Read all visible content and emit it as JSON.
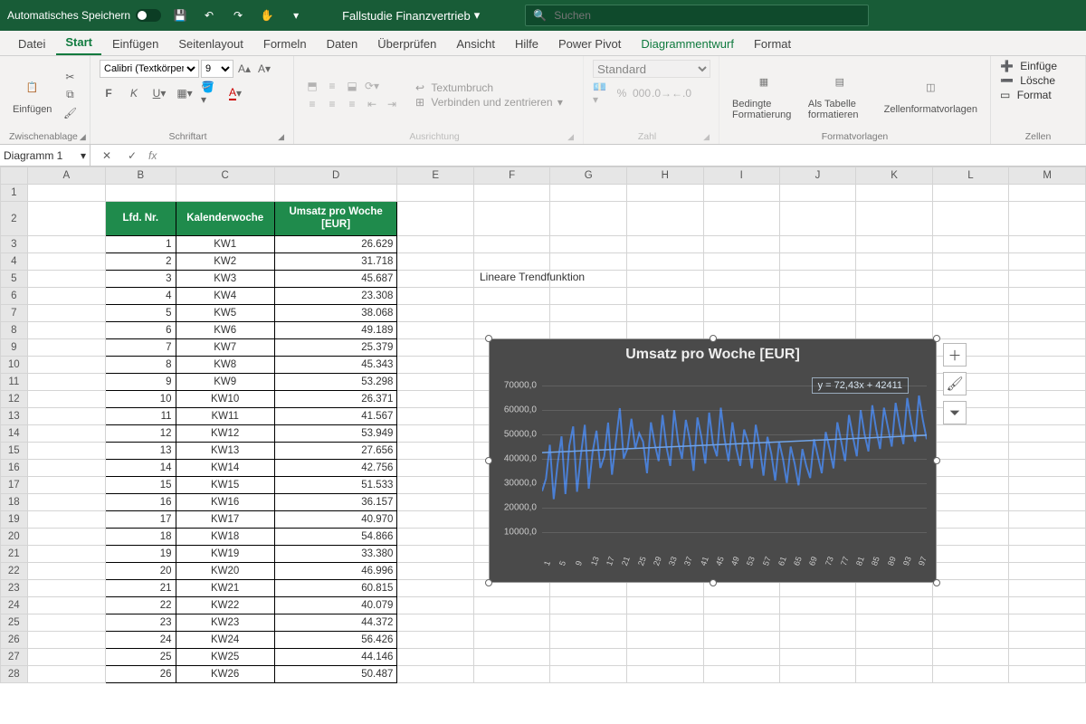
{
  "titlebar": {
    "autosave_label": "Automatisches Speichern",
    "doc_title": "Fallstudie Finanzvertrieb",
    "search_placeholder": "Suchen"
  },
  "tabs": {
    "datei": "Datei",
    "start": "Start",
    "einfuegen": "Einfügen",
    "seitenlayout": "Seitenlayout",
    "formeln": "Formeln",
    "daten": "Daten",
    "ueberpruefen": "Überprüfen",
    "ansicht": "Ansicht",
    "hilfe": "Hilfe",
    "powerpivot": "Power Pivot",
    "diagrammentwurf": "Diagrammentwurf",
    "format": "Format"
  },
  "ribbon": {
    "clipboard": {
      "label": "Zwischenablage",
      "paste": "Einfügen"
    },
    "font": {
      "label": "Schriftart",
      "font_name": "Calibri (Textkörper)",
      "font_size": "9"
    },
    "alignment": {
      "label": "Ausrichtung",
      "wrap": "Textumbruch",
      "merge": "Verbinden und zentrieren"
    },
    "number": {
      "label": "Zahl",
      "format": "Standard"
    },
    "styles": {
      "label": "Formatvorlagen",
      "conditional": "Bedingte Formatierung",
      "as_table": "Als Tabelle formatieren",
      "cell_styles": "Zellenformatvorlagen"
    },
    "cells": {
      "label": "Zellen",
      "insert": "Einfüge",
      "delete": "Lösche",
      "format": "Format"
    }
  },
  "namebox": "Diagramm 1",
  "sheet": {
    "headers": {
      "b": "Lfd. Nr.",
      "c": "Kalenderwoche",
      "d": "Umsatz pro Woche [EUR]"
    },
    "note": "Lineare Trendfunktion",
    "rows": [
      {
        "n": "1",
        "kw": "KW1",
        "v": "26.629"
      },
      {
        "n": "2",
        "kw": "KW2",
        "v": "31.718"
      },
      {
        "n": "3",
        "kw": "KW3",
        "v": "45.687"
      },
      {
        "n": "4",
        "kw": "KW4",
        "v": "23.308"
      },
      {
        "n": "5",
        "kw": "KW5",
        "v": "38.068"
      },
      {
        "n": "6",
        "kw": "KW6",
        "v": "49.189"
      },
      {
        "n": "7",
        "kw": "KW7",
        "v": "25.379"
      },
      {
        "n": "8",
        "kw": "KW8",
        "v": "45.343"
      },
      {
        "n": "9",
        "kw": "KW9",
        "v": "53.298"
      },
      {
        "n": "10",
        "kw": "KW10",
        "v": "26.371"
      },
      {
        "n": "11",
        "kw": "KW11",
        "v": "41.567"
      },
      {
        "n": "12",
        "kw": "KW12",
        "v": "53.949"
      },
      {
        "n": "13",
        "kw": "KW13",
        "v": "27.656"
      },
      {
        "n": "14",
        "kw": "KW14",
        "v": "42.756"
      },
      {
        "n": "15",
        "kw": "KW15",
        "v": "51.533"
      },
      {
        "n": "16",
        "kw": "KW16",
        "v": "36.157"
      },
      {
        "n": "17",
        "kw": "KW17",
        "v": "40.970"
      },
      {
        "n": "18",
        "kw": "KW18",
        "v": "54.866"
      },
      {
        "n": "19",
        "kw": "KW19",
        "v": "33.380"
      },
      {
        "n": "20",
        "kw": "KW20",
        "v": "46.996"
      },
      {
        "n": "21",
        "kw": "KW21",
        "v": "60.815"
      },
      {
        "n": "22",
        "kw": "KW22",
        "v": "40.079"
      },
      {
        "n": "23",
        "kw": "KW23",
        "v": "44.372"
      },
      {
        "n": "24",
        "kw": "KW24",
        "v": "56.426"
      },
      {
        "n": "25",
        "kw": "KW25",
        "v": "44.146"
      },
      {
        "n": "26",
        "kw": "KW26",
        "v": "50.487"
      }
    ]
  },
  "chart": {
    "title": "Umsatz pro Woche [EUR]",
    "equation": "y = 72,43x + 42411",
    "yticks": [
      "70000,0",
      "60000,0",
      "50000,0",
      "40000,0",
      "30000,0",
      "20000,0",
      "10000,0"
    ],
    "xticks": [
      "1",
      "5",
      "9",
      "13",
      "17",
      "21",
      "25",
      "29",
      "33",
      "37",
      "41",
      "45",
      "49",
      "53",
      "57",
      "61",
      "65",
      "69",
      "73",
      "77",
      "81",
      "85",
      "89",
      "93",
      "97"
    ]
  },
  "chart_data": {
    "type": "line",
    "title": "Umsatz pro Woche [EUR]",
    "xlabel": "",
    "ylabel": "",
    "ylim": [
      0,
      75000
    ],
    "x": [
      1,
      2,
      3,
      4,
      5,
      6,
      7,
      8,
      9,
      10,
      11,
      12,
      13,
      14,
      15,
      16,
      17,
      18,
      19,
      20,
      21,
      22,
      23,
      24,
      25,
      26,
      27,
      28,
      29,
      30,
      31,
      32,
      33,
      34,
      35,
      36,
      37,
      38,
      39,
      40,
      41,
      42,
      43,
      44,
      45,
      46,
      47,
      48,
      49,
      50,
      51,
      52,
      53,
      54,
      55,
      56,
      57,
      58,
      59,
      60,
      61,
      62,
      63,
      64,
      65,
      66,
      67,
      68,
      69,
      70,
      71,
      72,
      73,
      74,
      75,
      76,
      77,
      78,
      79,
      80,
      81,
      82,
      83,
      84,
      85,
      86,
      87,
      88,
      89,
      90,
      91,
      92,
      93,
      94,
      95,
      96,
      97,
      98,
      99,
      100
    ],
    "series": [
      {
        "name": "Umsatz",
        "values": [
          26629,
          31718,
          45687,
          23308,
          38068,
          49189,
          25379,
          45343,
          53298,
          26371,
          41567,
          53949,
          27656,
          42756,
          51533,
          36157,
          40970,
          54866,
          33380,
          46996,
          60815,
          40079,
          44372,
          56426,
          44146,
          50487,
          47000,
          34000,
          55000,
          46000,
          39000,
          58000,
          45000,
          37000,
          60000,
          47000,
          40000,
          56000,
          48000,
          35000,
          57000,
          49000,
          38000,
          59000,
          46000,
          41000,
          61000,
          48000,
          39000,
          55000,
          44000,
          37000,
          52000,
          47000,
          36000,
          54000,
          45000,
          33000,
          49000,
          42000,
          31000,
          47000,
          40000,
          30000,
          45000,
          38000,
          29000,
          44000,
          37000,
          32000,
          48000,
          41000,
          34000,
          51000,
          44000,
          36000,
          55000,
          47000,
          39000,
          58000,
          49000,
          41000,
          60000,
          50000,
          43000,
          62000,
          52000,
          44000,
          61000,
          53000,
          45000,
          63000,
          54000,
          46000,
          65000,
          55000,
          47000,
          66000,
          56000,
          48000
        ]
      }
    ],
    "trendline": {
      "type": "linear",
      "slope": 72.43,
      "intercept": 42411
    }
  }
}
